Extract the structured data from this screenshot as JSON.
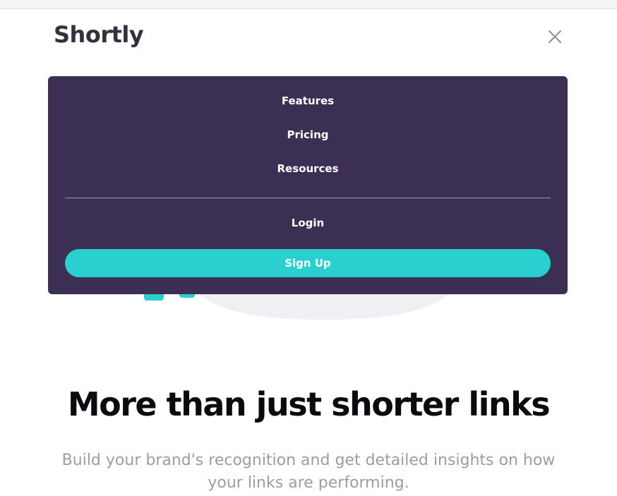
{
  "header": {
    "logo": "Shortly",
    "close_icon": "close-icon"
  },
  "menu": {
    "links": {
      "features": "Features",
      "pricing": "Pricing",
      "resources": "Resources"
    },
    "login": "Login",
    "signup": "Sign Up"
  },
  "hero": {
    "title": "More than just shorter links",
    "subtitle": "Build your brand's recognition and get detailed insights on how your links are performing."
  },
  "colors": {
    "menu_bg": "#3b3054",
    "accent_cyan": "#2acfcf",
    "dark_text": "#34313d",
    "gray_text": "#9e9aa7"
  }
}
